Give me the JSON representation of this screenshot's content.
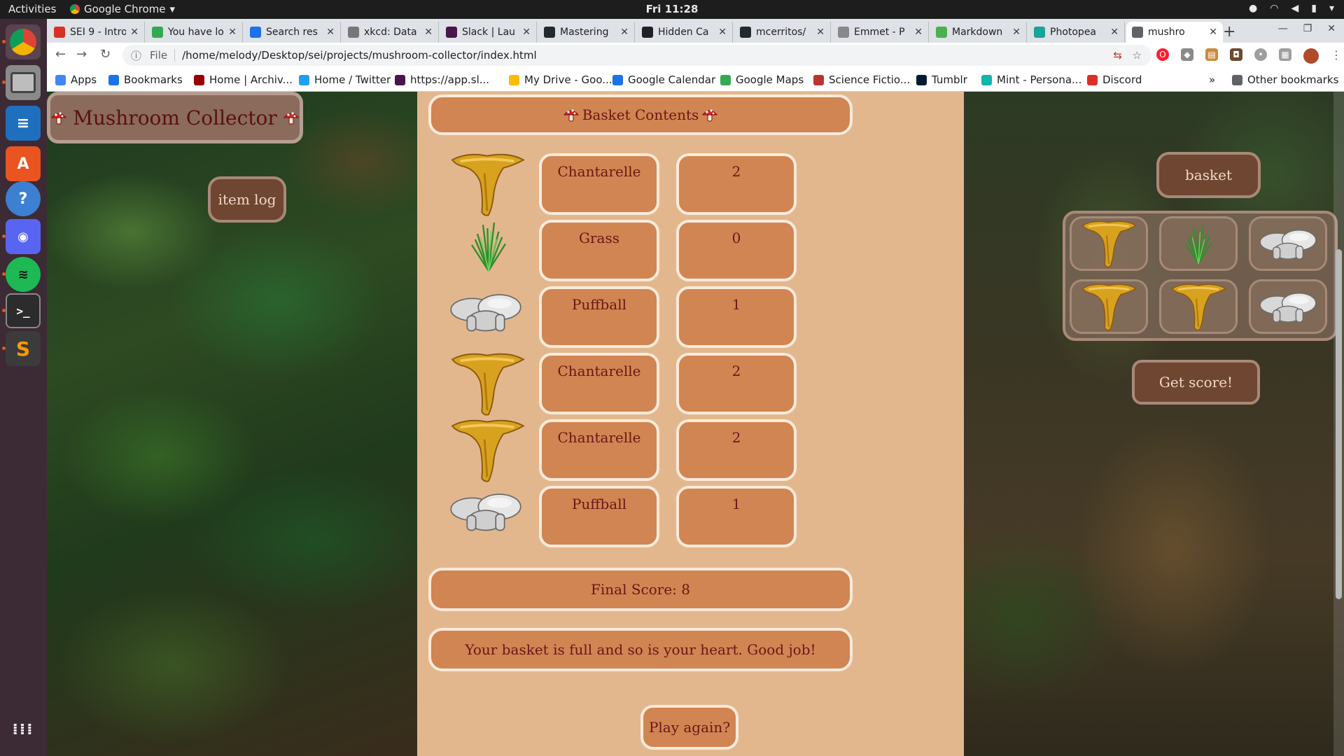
{
  "system": {
    "activities": "Activities",
    "app_name": "Google Chrome",
    "clock": "Fri 11:28"
  },
  "tabs": [
    {
      "title": "SEI 9 - Intro",
      "icon": "gmail-icon",
      "color": "#d93025"
    },
    {
      "title": "You have lo",
      "icon": "leaf-icon",
      "color": "#34a853"
    },
    {
      "title": "Search res",
      "icon": "drive-icon",
      "color": "#1a73e8"
    },
    {
      "title": "xkcd: Data",
      "icon": "xkcd-icon",
      "color": "#777777"
    },
    {
      "title": "Slack | Lau",
      "icon": "slack-icon",
      "color": "#4a154b"
    },
    {
      "title": "Mastering",
      "icon": "github-icon",
      "color": "#24292e"
    },
    {
      "title": "Hidden Ca",
      "icon": "hidden-icon",
      "color": "#202124"
    },
    {
      "title": "mcerritos/",
      "icon": "github-icon",
      "color": "#24292e"
    },
    {
      "title": "Emmet - P",
      "icon": "emmet-icon",
      "color": "#888888"
    },
    {
      "title": "Markdown",
      "icon": "leaf-icon",
      "color": "#4caf50"
    },
    {
      "title": "Photopea",
      "icon": "photopea-icon",
      "color": "#18a497"
    },
    {
      "title": "mushro",
      "icon": "globe-icon",
      "color": "#5f6368"
    }
  ],
  "address": {
    "scheme": "File",
    "url": "/home/melody/Desktop/sei/projects/mushroom-collector/index.html"
  },
  "bookmarks": [
    {
      "label": "Apps",
      "icon": "apps-icon",
      "color": "#4285f4"
    },
    {
      "label": "Bookmarks",
      "icon": "star-icon",
      "color": "#1a73e8"
    },
    {
      "label": "Home | Archiv...",
      "icon": "archive-icon",
      "color": "#990000"
    },
    {
      "label": "Home / Twitter",
      "icon": "twitter-icon",
      "color": "#1da1f2"
    },
    {
      "label": "https://app.sl...",
      "icon": "slack-icon",
      "color": "#4a154b"
    },
    {
      "label": "My Drive - Goo...",
      "icon": "drive-icon",
      "color": "#fbbc04"
    },
    {
      "label": "Google Calendar",
      "icon": "calendar-icon",
      "color": "#1a73e8"
    },
    {
      "label": "Google Maps",
      "icon": "maps-icon",
      "color": "#34a853"
    },
    {
      "label": "Science Fictio...",
      "icon": "book-icon",
      "color": "#b33"
    },
    {
      "label": "Tumblr",
      "icon": "tumblr-icon",
      "color": "#001935"
    },
    {
      "label": "Mint - Persona...",
      "icon": "mint-icon",
      "color": "#0fb5ae"
    },
    {
      "label": "Discord",
      "icon": "discord-icon",
      "color": "#d93025"
    }
  ],
  "bookmarks_more": "»",
  "other_bookmarks": "Other bookmarks",
  "game": {
    "title": "Mushroom Collector",
    "item_log": "item log",
    "basket_contents": "Basket Contents",
    "items": [
      {
        "name": "Chantarelle",
        "value": "2",
        "kind": "chanterelle"
      },
      {
        "name": "Grass",
        "value": "0",
        "kind": "grass"
      },
      {
        "name": "Puffball",
        "value": "1",
        "kind": "puffball"
      },
      {
        "name": "Chantarelle",
        "value": "2",
        "kind": "chanterelle"
      },
      {
        "name": "Chantarelle",
        "value": "2",
        "kind": "chanterelle"
      },
      {
        "name": "Puffball",
        "value": "1",
        "kind": "puffball"
      }
    ],
    "final_score": "Final Score: 8",
    "message": "Your basket is full and so is your heart. Good job!",
    "play_again": "Play again?",
    "basket": "basket",
    "get_score": "Get score!",
    "basket_slots": [
      "chanterelle",
      "grass",
      "puffball",
      "chanterelle",
      "chanterelle",
      "puffball"
    ]
  }
}
